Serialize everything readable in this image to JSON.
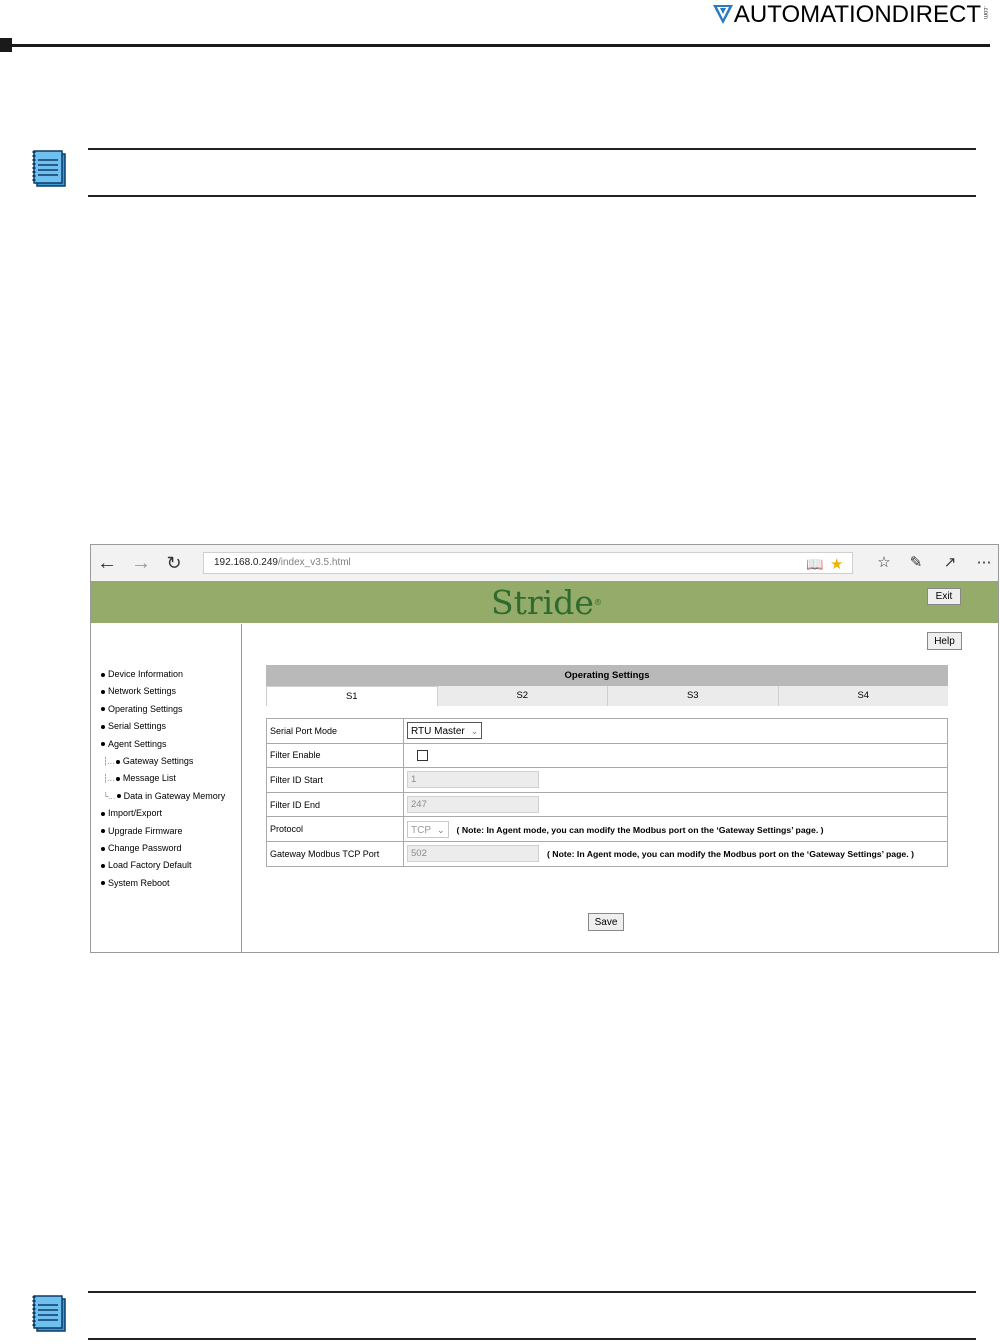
{
  "page_header": {
    "logo_text": "AUTOMATIONDIRECT",
    "logo_suffix": ".com"
  },
  "browser": {
    "url_host": "192.168.0.249",
    "url_path": "/index_v3.5.html",
    "icons": [
      "back-arrow-icon",
      "forward-arrow-icon",
      "refresh-icon",
      "reading-view-icon",
      "favorite-star-icon",
      "favorites-list-icon",
      "pen-icon",
      "share-icon",
      "more-icon"
    ]
  },
  "app": {
    "brand": "Stride",
    "brand_mark": "®",
    "exit_label": "Exit",
    "help_label": "Help",
    "save_label": "Save",
    "menu": [
      {
        "label": "Device Information"
      },
      {
        "label": "Network Settings"
      },
      {
        "label": "Operating Settings"
      },
      {
        "label": "Serial Settings"
      },
      {
        "label": "Agent Settings"
      },
      {
        "label": "Gateway Settings"
      },
      {
        "label": "Message List"
      },
      {
        "label": "Data in Gateway Memory"
      },
      {
        "label": "Import/Export"
      },
      {
        "label": "Upgrade Firmware"
      },
      {
        "label": "Change Password"
      },
      {
        "label": "Load Factory Default"
      },
      {
        "label": "System Reboot"
      }
    ],
    "panel_title": "Operating Settings",
    "tabs": [
      {
        "label": "S1",
        "active": true
      },
      {
        "label": "S2"
      },
      {
        "label": "S3"
      },
      {
        "label": "S4"
      }
    ],
    "form": {
      "serial_port_mode": {
        "label": "Serial Port Mode",
        "value": "RTU Master"
      },
      "filter_enable": {
        "label": "Filter Enable",
        "checked": false
      },
      "filter_id_start": {
        "label": "Filter ID Start",
        "value": "1"
      },
      "filter_id_end": {
        "label": "Filter ID End",
        "value": "247"
      },
      "protocol": {
        "label": "Protocol",
        "value": "TCP",
        "note": "( Note: In Agent mode, you can modify the Modbus port on the ‘Gateway Settings’ page. )"
      },
      "gateway_port": {
        "label": "Gateway Modbus TCP Port",
        "value": "502",
        "note": "( Note: In Agent mode, you can modify the Modbus port on the ‘Gateway Settings’ page. )"
      }
    }
  },
  "colors": {
    "banner": "#94ab6a",
    "brand_text": "#2f6b2f",
    "panel_header": "#b9b9b9",
    "note_icon": "#3a9ad9"
  }
}
